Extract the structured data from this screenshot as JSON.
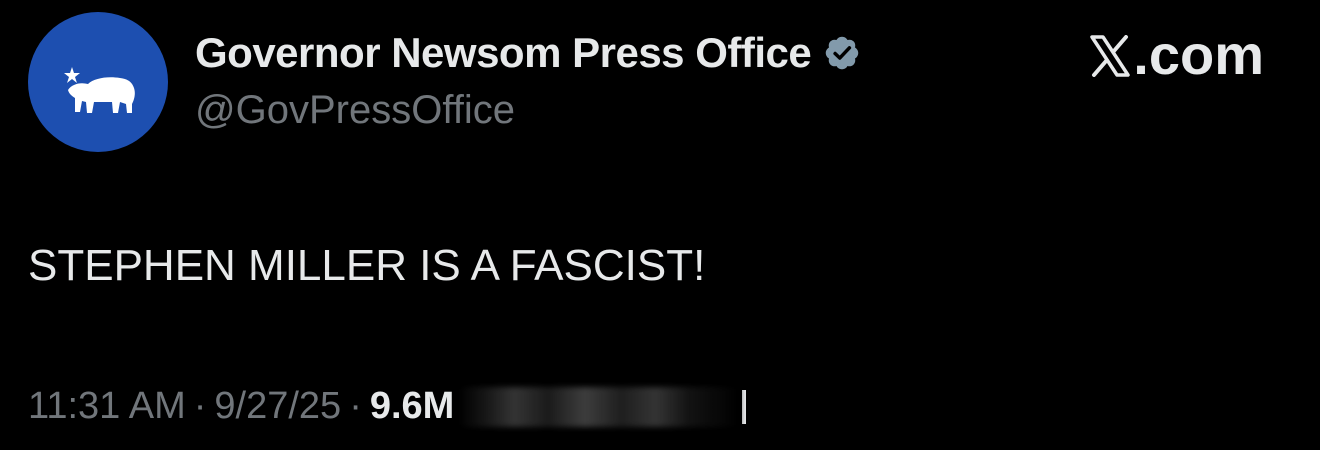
{
  "author": {
    "display_name": "Governor Newsom Press Office",
    "handle": "@GovPressOffice",
    "verified": true,
    "avatar_icon": "california-bear-flag-icon",
    "avatar_color": "#1d4fb0"
  },
  "brand": {
    "label": ".com",
    "icon": "x-logo-icon"
  },
  "tweet": {
    "text": "STEPHEN MILLER IS A FASCIST!"
  },
  "meta": {
    "time": "11:31 AM",
    "separator": "·",
    "date": "9/27/25",
    "views_count": "9.6M"
  },
  "colors": {
    "background": "#000000",
    "text_primary": "#e7e9ea",
    "text_secondary": "#71767b",
    "verified_badge": "#829aab"
  }
}
